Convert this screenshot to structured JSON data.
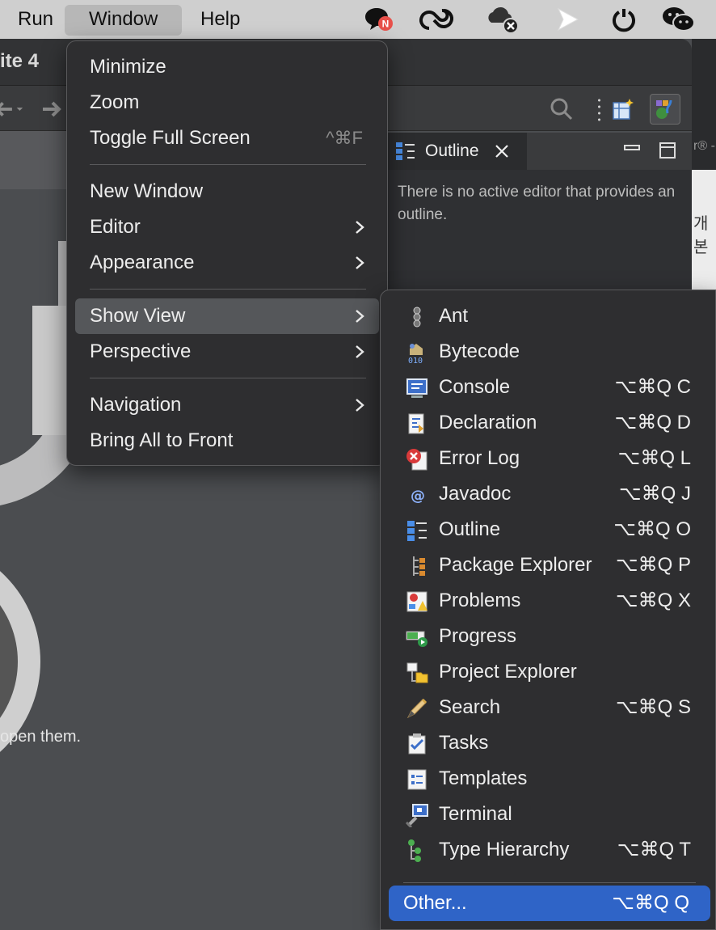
{
  "menubar": {
    "items": [
      "Run",
      "Window",
      "Help"
    ],
    "tray_icons": [
      "chat-notification-icon",
      "creative-cloud-icon",
      "cloud-offline-icon",
      "play-icon",
      "power-icon",
      "wechat-icon"
    ],
    "notification_badge": "N"
  },
  "ide": {
    "title": "ite 4",
    "background_hint": "open them.",
    "outline": {
      "tab_label": "Outline",
      "message": "There is no active editor that provides an outline."
    },
    "right_edge_text": "개본",
    "right_edge_small": "r® -"
  },
  "window_menu": {
    "items": [
      {
        "label": "Minimize",
        "shortcut": ""
      },
      {
        "label": "Zoom",
        "shortcut": ""
      },
      {
        "label": "Toggle Full Screen",
        "shortcut": "^⌘F"
      },
      {
        "label": "New Window",
        "shortcut": ""
      },
      {
        "label": "Editor",
        "shortcut": ""
      },
      {
        "label": "Appearance",
        "shortcut": ""
      },
      {
        "label": "Show View",
        "shortcut": ""
      },
      {
        "label": "Perspective",
        "shortcut": ""
      },
      {
        "label": "Navigation",
        "shortcut": ""
      },
      {
        "label": "Bring All to Front",
        "shortcut": ""
      }
    ],
    "highlighted": "Show View"
  },
  "show_view_menu": {
    "items": [
      {
        "label": "Ant",
        "shortcut": "",
        "icon": "ant-icon"
      },
      {
        "label": "Bytecode",
        "shortcut": "",
        "icon": "bytecode-icon"
      },
      {
        "label": "Console",
        "shortcut": "⌥⌘Q C",
        "icon": "console-icon"
      },
      {
        "label": "Declaration",
        "shortcut": "⌥⌘Q D",
        "icon": "declaration-icon"
      },
      {
        "label": "Error Log",
        "shortcut": "⌥⌘Q L",
        "icon": "error-log-icon"
      },
      {
        "label": "Javadoc",
        "shortcut": "⌥⌘Q J",
        "icon": "javadoc-icon"
      },
      {
        "label": "Outline",
        "shortcut": "⌥⌘Q O",
        "icon": "outline-icon"
      },
      {
        "label": "Package Explorer",
        "shortcut": "⌥⌘Q P",
        "icon": "package-explorer-icon"
      },
      {
        "label": "Problems",
        "shortcut": "⌥⌘Q X",
        "icon": "problems-icon"
      },
      {
        "label": "Progress",
        "shortcut": "",
        "icon": "progress-icon"
      },
      {
        "label": "Project Explorer",
        "shortcut": "",
        "icon": "project-explorer-icon"
      },
      {
        "label": "Search",
        "shortcut": "⌥⌘Q S",
        "icon": "search-view-icon"
      },
      {
        "label": "Tasks",
        "shortcut": "",
        "icon": "tasks-icon"
      },
      {
        "label": "Templates",
        "shortcut": "",
        "icon": "templates-icon"
      },
      {
        "label": "Terminal",
        "shortcut": "",
        "icon": "terminal-icon"
      },
      {
        "label": "Type Hierarchy",
        "shortcut": "⌥⌘Q T",
        "icon": "type-hierarchy-icon"
      }
    ],
    "other": {
      "label": "Other...",
      "shortcut": "⌥⌘Q Q"
    }
  },
  "colors": {
    "selection": "#2f64c7",
    "menu_bg": "#2e2e30",
    "menubar_bg": "#cfcfcf"
  }
}
